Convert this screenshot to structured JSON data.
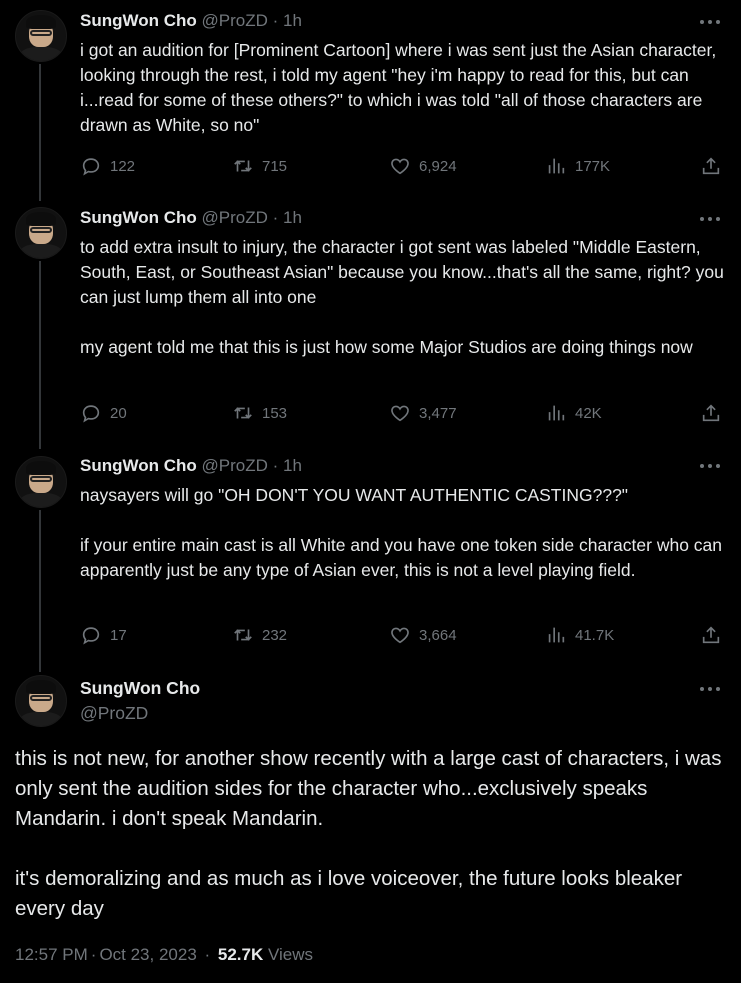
{
  "author": {
    "name": "SungWon Cho",
    "handle": "@ProZD"
  },
  "thread": [
    {
      "time": "1h",
      "paragraphs": [
        "i got an audition for [Prominent Cartoon] where i was sent just the Asian character, looking through the rest, i told my agent \"hey i'm happy to read for this, but can i...read for some of these others?\" to which i was told \"all of those characters are drawn as White, so no\""
      ],
      "stats": {
        "replies": "122",
        "reposts": "715",
        "likes": "6,924",
        "views": "177K"
      }
    },
    {
      "time": "1h",
      "paragraphs": [
        "to add extra insult to injury, the character i got sent was labeled \"Middle Eastern, South, East, or Southeast Asian\" because you know...that's all the same, right? you can just lump them all into one",
        "my agent told me that this is just how some Major Studios are doing things now"
      ],
      "stats": {
        "replies": "20",
        "reposts": "153",
        "likes": "3,477",
        "views": "42K"
      }
    },
    {
      "time": "1h",
      "paragraphs": [
        "naysayers will go \"OH DON'T YOU WANT AUTHENTIC CASTING???\"",
        "if your entire main cast is all White and you have one token side character who can apparently just be any type of Asian ever, this is not a level playing field."
      ],
      "stats": {
        "replies": "17",
        "reposts": "232",
        "likes": "3,664",
        "views": "41.7K"
      }
    }
  ],
  "main_tweet": {
    "paragraphs": [
      "this is not new, for another show recently with a large cast of characters, i was only sent the audition sides for the character who...exclusively speaks Mandarin. i don't speak Mandarin.",
      "it's demoralizing and as much as i love voiceover, the future looks bleaker every day"
    ],
    "time": "12:57 PM",
    "date": "Oct 23, 2023",
    "views_count": "52.7K",
    "views_label": "Views"
  },
  "icons": {
    "reply": "reply-icon",
    "repost": "repost-icon",
    "like": "heart-icon",
    "views": "views-icon",
    "share": "share-icon",
    "more": "more-icon"
  },
  "colors": {
    "background": "#000000",
    "text": "#e7e9ea",
    "muted": "#71767b",
    "line": "#333639"
  }
}
